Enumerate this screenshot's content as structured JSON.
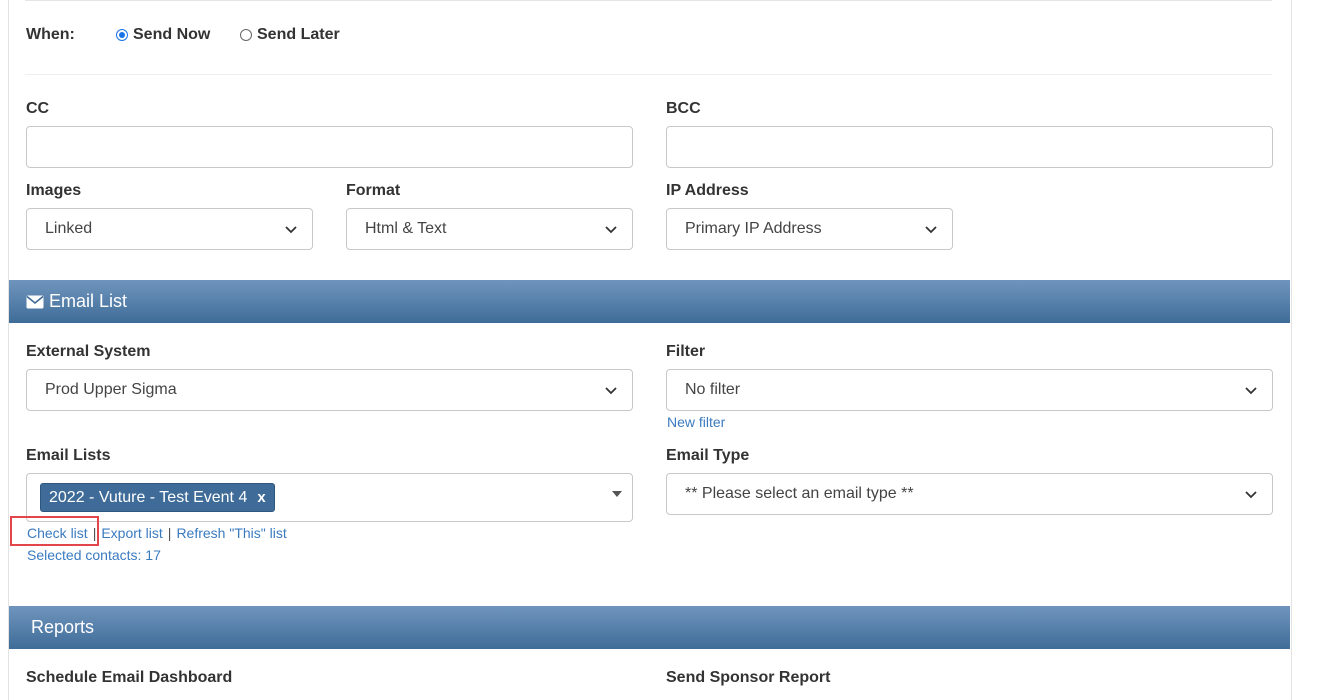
{
  "when": {
    "label": "When:",
    "options": [
      {
        "label": "Send Now",
        "selected": true
      },
      {
        "label": "Send Later",
        "selected": false
      }
    ]
  },
  "cc": {
    "label": "CC",
    "value": ""
  },
  "bcc": {
    "label": "BCC",
    "value": ""
  },
  "images": {
    "label": "Images",
    "value": "Linked"
  },
  "format": {
    "label": "Format",
    "value": "Html & Text"
  },
  "ip_address": {
    "label": "IP Address",
    "value": "Primary IP Address"
  },
  "email_list_section": {
    "title": "Email List",
    "icon": "envelope-icon",
    "external_system": {
      "label": "External System",
      "value": "Prod Upper Sigma"
    },
    "filter": {
      "label": "Filter",
      "value": "No filter",
      "new_filter_link": "New filter"
    },
    "email_lists": {
      "label": "Email Lists",
      "tags": [
        "2022 - Vuture - Test Event 4"
      ],
      "tag_remove": "x"
    },
    "email_type": {
      "label": "Email Type",
      "value": "** Please select an email type **"
    },
    "links": {
      "check_list": "Check list",
      "export_list": "Export list",
      "refresh_list": "Refresh \"This\" list",
      "separator": "|"
    },
    "selected_contacts": "Selected contacts: 17"
  },
  "reports_section": {
    "title": "Reports",
    "schedule_dashboard_label": "Schedule Email Dashboard",
    "sponsor_report_label": "Send Sponsor Report"
  },
  "colors": {
    "band_top": "#6f95bd",
    "band_bottom": "#3f6c98",
    "link": "#3a7bc0",
    "highlight": "#e2454a",
    "tag": "#3e6b98"
  }
}
